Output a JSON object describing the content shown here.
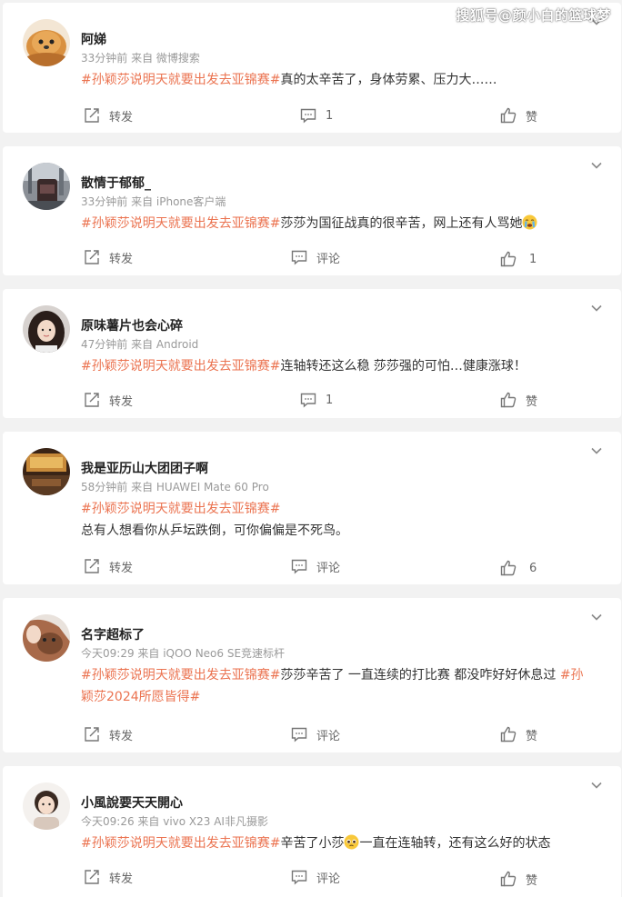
{
  "watermark": "搜狐号@颜小白的篮球梦",
  "colors": {
    "tag": "#eb7350",
    "meta": "#999999",
    "background": "#f2f2f2"
  },
  "posts": [
    {
      "name": "阿娣",
      "meta": "33分钟前 来自 微博搜索",
      "tag": "#孙颖莎说明天就要出发去亚锦赛#",
      "text": "真的太辛苦了，身体劳累、压力大……",
      "forward": "转发",
      "comment": "1",
      "like": "赞",
      "avatar": "dog"
    },
    {
      "name": "散情于郁郁_",
      "meta": "33分钟前 来自 iPhone客户端",
      "tag": "#孙颖莎说明天就要出发去亚锦赛#",
      "text": "莎莎为国征战真的很辛苦，网上还有人骂她",
      "emoji": "crying-face",
      "forward": "转发",
      "comment": "评论",
      "like": "1",
      "avatar": "bag"
    },
    {
      "name": "原味薯片也会心碎",
      "meta": "47分钟前 来自 Android",
      "tag": "#孙颖莎说明天就要出发去亚锦赛#",
      "text": "连轴转还这么稳 莎莎强的可怕…健康涨球！",
      "forward": "转发",
      "comment": "1",
      "like": "赞",
      "avatar": "girl"
    },
    {
      "name": "我是亚历山大团团子啊",
      "meta": "58分钟前 来自 HUAWEI Mate 60 Pro",
      "tag": "#孙颖莎说明天就要出发去亚锦赛#",
      "text2": "总有人想看你从乒坛跌倒，可你偏偏是不死鸟。",
      "forward": "转发",
      "comment": "评论",
      "like": "6",
      "avatar": "room"
    },
    {
      "name": "名字超标了",
      "meta": "今天09:29 来自 iQOO Neo6 SE竞速标杆",
      "tag": "#孙颖莎说明天就要出发去亚锦赛#",
      "text": "莎莎辛苦了 一直连续的打比赛 都没咋好好休息过 ",
      "tag2a": "#孙",
      "tag2b": "颖莎2024所愿皆得#",
      "forward": "转发",
      "comment": "评论",
      "like": "赞",
      "avatar": "cat"
    },
    {
      "name": "小風說要天天開心",
      "meta": "今天09:26 来自 vivo X23 AI非凡摄影",
      "tag": "#孙颖莎说明天就要出发去亚锦赛#",
      "text": "辛苦了小莎",
      "emoji": "pleading-face",
      "text3": "一直在连轴转，还有这么好的状态",
      "forward": "转发",
      "comment": "评论",
      "like": "赞",
      "avatar": "kid"
    }
  ]
}
